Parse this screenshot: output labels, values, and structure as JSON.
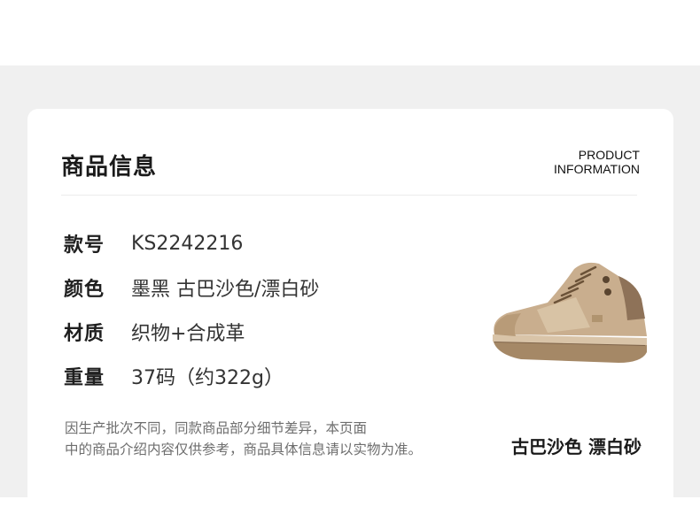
{
  "section": {
    "title": "商品信息",
    "title_en_line1": "PRODUCT",
    "title_en_line2": "INFORMATION"
  },
  "specs": [
    {
      "label": "款号",
      "value": "KS2242216"
    },
    {
      "label": "颜色",
      "value": "墨黑 古巴沙色/漂白砂"
    },
    {
      "label": "材质",
      "value": "织物+合成革"
    },
    {
      "label": "重量",
      "value": "37码（约322g）"
    }
  ],
  "note": {
    "line1": "因生产批次不同，同款商品部分细节差异，本页面",
    "line2": "中的商品介绍内容仅供参考，商品具体信息请以实物为准。"
  },
  "product_image": {
    "color_caption": "古巴沙色 漂白砂",
    "icon": "hiking-shoe-image"
  },
  "colors": {
    "page_bg": "#f0f0f0",
    "card_bg": "#ffffff",
    "shoe_main": "#c9ae8e",
    "shoe_dark": "#8e7258"
  }
}
